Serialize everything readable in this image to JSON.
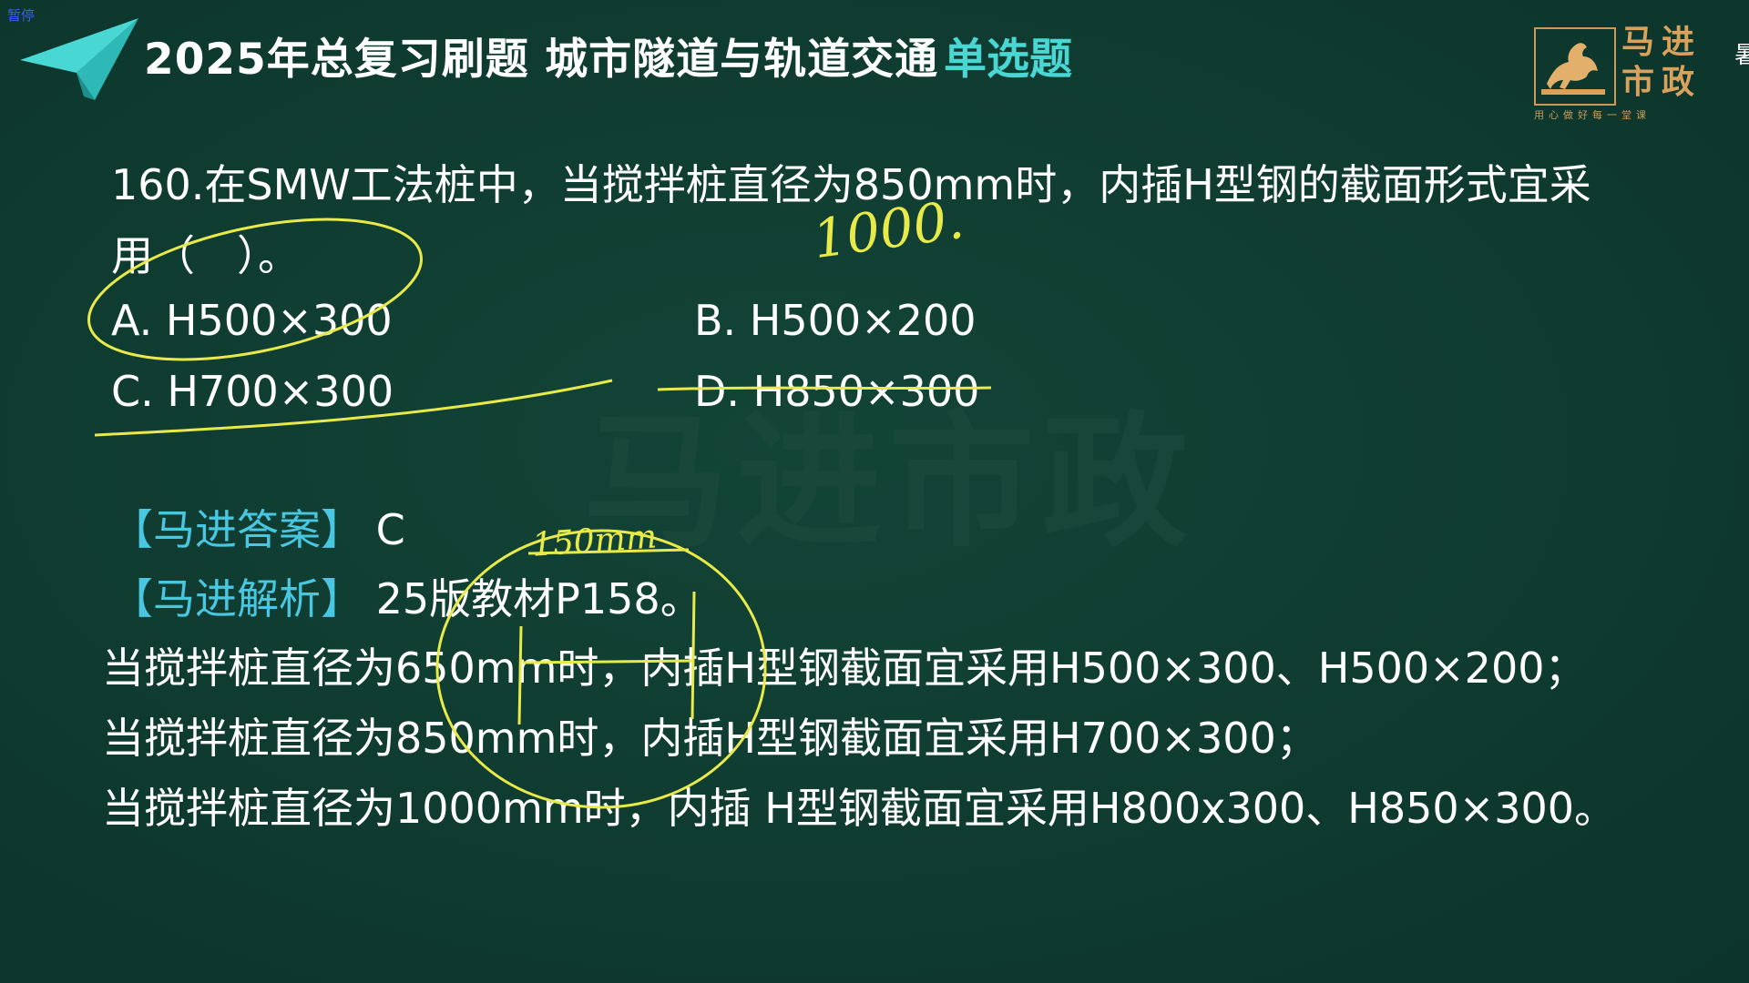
{
  "status": {
    "pause_label": "暂停"
  },
  "header": {
    "title": "2025年总复习刷题 城市隧道与轨道交通",
    "tag": "单选题",
    "accent_color": "#49d7d4",
    "icon": "paper-plane-icon"
  },
  "logo": {
    "char1": "马",
    "char2": "进",
    "char3": "市",
    "char4": "政",
    "slogan": "用心做好每一堂课",
    "icon": "horse-icon"
  },
  "edge_char": "暑",
  "question": {
    "text": "160.在SMW工法桩中，当搅拌桩直径为850mm时，内插H型钢的截面形式宜采用（　）。",
    "options": [
      {
        "label": "A. H500×300"
      },
      {
        "label": "B. H500×200"
      },
      {
        "label": "C. H700×300"
      },
      {
        "label": "D. H850×300"
      }
    ]
  },
  "answer": {
    "label": "【马进答案】",
    "value": "C"
  },
  "analysis": {
    "label": "【马进解析】",
    "text": "25版教材P158。",
    "lines": [
      "当搅拌桩直径为650mm时，内插H型钢截面宜采用H500×300、H500×200；",
      "当搅拌桩直径为850mm时，内插H型钢截面宜采用H700×300；",
      "当搅拌桩直径为1000mm时，内插 H型钢截面宜采用H800x300、H850×300。"
    ]
  },
  "watermark": "马进市政",
  "handwriting": {
    "note_top": "1000.",
    "note_circle": "150mm",
    "color": "#e8ea4a"
  }
}
